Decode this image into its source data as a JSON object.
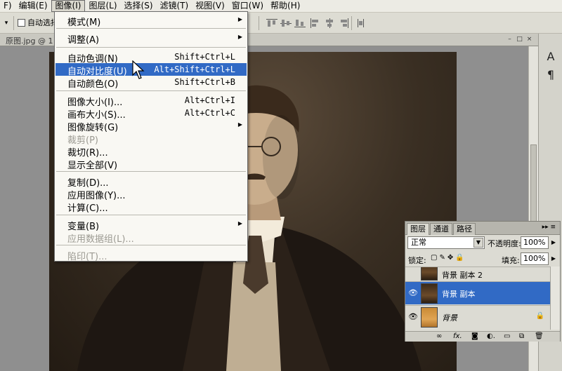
{
  "menubar": {
    "items": [
      {
        "label": "F)"
      },
      {
        "label": "编辑(E)"
      },
      {
        "label": "图像(I)"
      },
      {
        "label": "图层(L)"
      },
      {
        "label": "选择(S)"
      },
      {
        "label": "滤镜(T)"
      },
      {
        "label": "视图(V)"
      },
      {
        "label": "窗口(W)"
      },
      {
        "label": "帮助(H)"
      }
    ]
  },
  "options": {
    "auto_select_label": "自动选择",
    "tool_icon": "move-tool-icon"
  },
  "document": {
    "tab_title": "原图.jpg @ 1"
  },
  "image_menu": {
    "items": [
      {
        "label": "模式(M)",
        "shortcut": "",
        "submenu": true
      },
      {
        "label": "调整(A)",
        "shortcut": "",
        "submenu": true
      },
      {
        "label": "自动色调(N)",
        "shortcut": "Shift+Ctrl+L"
      },
      {
        "label": "自动对比度(U)",
        "shortcut": "Alt+Shift+Ctrl+L",
        "highlighted": true
      },
      {
        "label": "自动颜色(O)",
        "shortcut": "Shift+Ctrl+B"
      },
      {
        "label": "图像大小(I)...",
        "shortcut": "Alt+Ctrl+I"
      },
      {
        "label": "画布大小(S)...",
        "shortcut": "Alt+Ctrl+C"
      },
      {
        "label": "图像旋转(G)",
        "shortcut": "",
        "submenu": true
      },
      {
        "label": "裁剪(P)",
        "shortcut": "",
        "disabled": true
      },
      {
        "label": "裁切(R)...",
        "shortcut": ""
      },
      {
        "label": "显示全部(V)",
        "shortcut": ""
      },
      {
        "label": "复制(D)...",
        "shortcut": ""
      },
      {
        "label": "应用图像(Y)...",
        "shortcut": ""
      },
      {
        "label": "计算(C)...",
        "shortcut": ""
      },
      {
        "label": "变量(B)",
        "shortcut": "",
        "submenu": true
      },
      {
        "label": "应用数据组(L)...",
        "shortcut": "",
        "disabled": true
      },
      {
        "label": "陷印(T)...",
        "shortcut": "",
        "disabled": true
      }
    ]
  },
  "layers_panel": {
    "tabs": [
      "图层",
      "通道",
      "路径"
    ],
    "active_tab": "图层",
    "blend_mode": "正常",
    "opacity_label": "不透明度:",
    "opacity_value": "100%",
    "lock_label": "锁定:",
    "fill_label": "填充:",
    "fill_value": "100%",
    "layers": [
      {
        "name": "背景 副本 2",
        "visible": false,
        "selected": false
      },
      {
        "name": "背景 副本",
        "visible": true,
        "selected": true
      },
      {
        "name": "背景",
        "visible": true,
        "selected": false,
        "locked": true
      }
    ],
    "bottom_icons": [
      "link-icon",
      "fx-icon",
      "mask-icon",
      "adjustment-icon",
      "group-icon",
      "new-layer-icon",
      "delete-icon"
    ]
  },
  "colors": {
    "highlight": "#316ac5",
    "menu_bg": "#f9f8f3",
    "panel_bg": "#dcdbd3"
  }
}
